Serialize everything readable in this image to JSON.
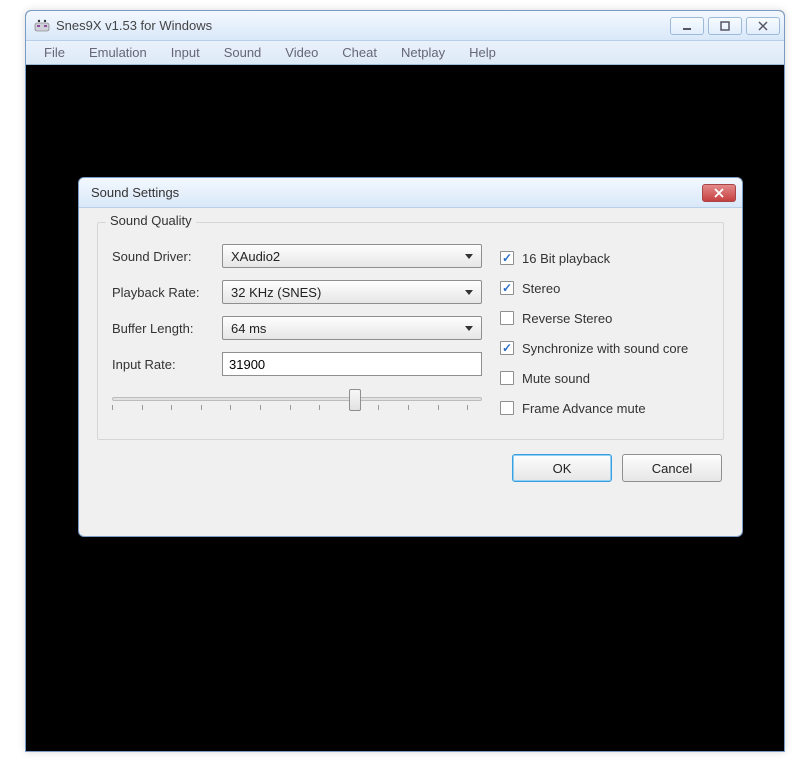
{
  "main_window": {
    "title": "Snes9X v1.53 for Windows",
    "menus": [
      "File",
      "Emulation",
      "Input",
      "Sound",
      "Video",
      "Cheat",
      "Netplay",
      "Help"
    ]
  },
  "dialog": {
    "title": "Sound Settings",
    "group_label": "Sound Quality",
    "labels": {
      "sound_driver": "Sound Driver:",
      "playback_rate": "Playback Rate:",
      "buffer_length": "Buffer Length:",
      "input_rate": "Input Rate:"
    },
    "values": {
      "sound_driver": "XAudio2",
      "playback_rate": "32 KHz (SNES)",
      "buffer_length": "64 ms",
      "input_rate": "31900"
    },
    "checkboxes": [
      {
        "label": "16 Bit playback",
        "checked": true
      },
      {
        "label": "Stereo",
        "checked": true
      },
      {
        "label": "Reverse Stereo",
        "checked": false
      },
      {
        "label": "Synchronize with sound core",
        "checked": true
      },
      {
        "label": "Mute sound",
        "checked": false
      },
      {
        "label": "Frame Advance mute",
        "checked": false
      }
    ],
    "buttons": {
      "ok": "OK",
      "cancel": "Cancel"
    }
  }
}
